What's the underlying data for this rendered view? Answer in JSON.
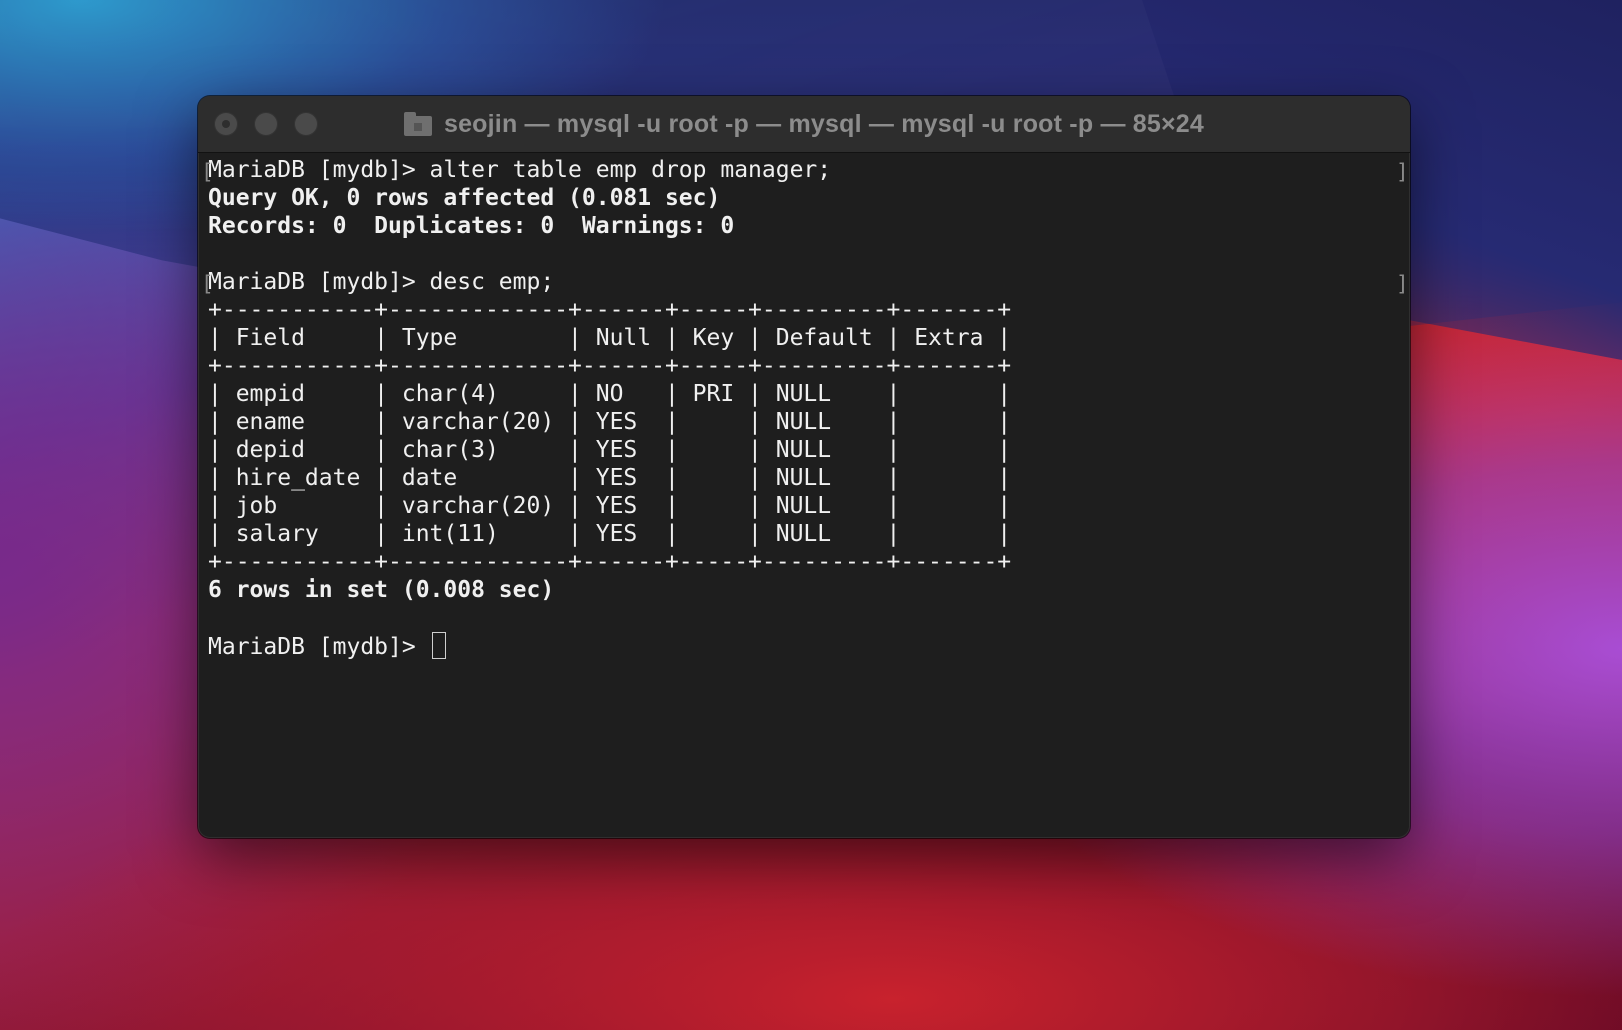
{
  "window": {
    "title": "seojin — mysql -u root -p — mysql — mysql -u root -p — 85×24",
    "folder_icon": "home-folder-icon"
  },
  "terminal": {
    "lines": [
      "MariaDB [mydb]> alter table emp drop manager;",
      "Query OK, 0 rows affected (0.081 sec)",
      "Records: 0  Duplicates: 0  Warnings: 0",
      "",
      "MariaDB [mydb]> desc emp;",
      "+-----------+-------------+------+-----+---------+-------+",
      "| Field     | Type        | Null | Key | Default | Extra |",
      "+-----------+-------------+------+-----+---------+-------+",
      "| empid     | char(4)     | NO   | PRI | NULL    |       |",
      "| ename     | varchar(20) | YES  |     | NULL    |       |",
      "| depid     | char(3)     | YES  |     | NULL    |       |",
      "| hire_date | date        | YES  |     | NULL    |       |",
      "| job       | varchar(20) | YES  |     | NULL    |       |",
      "| salary    | int(11)     | YES  |     | NULL    |       |",
      "+-----------+-------------+------+-----+---------+-------+",
      "6 rows in set (0.008 sec)",
      "",
      "MariaDB [mydb]> "
    ],
    "prompt_line": "MariaDB [mydb]> "
  }
}
